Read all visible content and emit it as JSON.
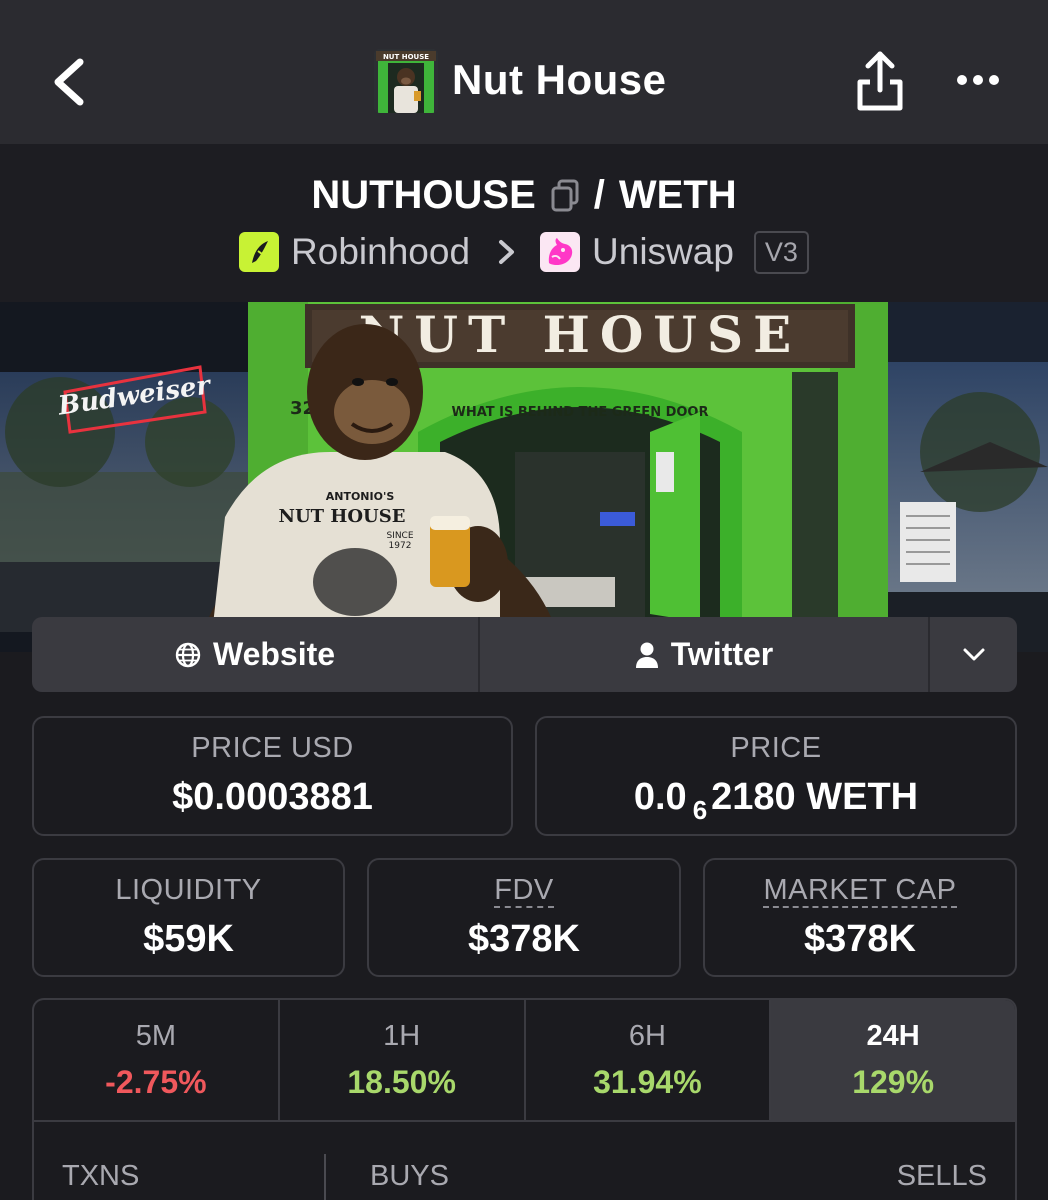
{
  "nav": {
    "title": "Nut House"
  },
  "pair": {
    "base_token": "NUTHOUSE",
    "separator": "/",
    "quote_token": "WETH",
    "chain": "Robinhood",
    "dex": "Uniswap",
    "version": "V3"
  },
  "banner": {
    "sign_text": "NUT HOUSE",
    "neon_text": "Budweiser",
    "door_text": "WHAT IS BEHIND THE GREEN DOOR",
    "shirt_top": "ANTONIO'S",
    "shirt_main": "NUT HOUSE",
    "shirt_since": "SINCE",
    "shirt_year": "1972",
    "street_number": "32"
  },
  "links": {
    "website_label": "Website",
    "twitter_label": "Twitter"
  },
  "stats": {
    "price_usd_label": "PRICE USD",
    "price_usd_value": "$0.0003881",
    "price_label": "PRICE",
    "price_prefix": "0.0",
    "price_zeros": "6",
    "price_digits": "2180 WETH",
    "liquidity_label": "LIQUIDITY",
    "liquidity_value": "$59K",
    "fdv_label": "FDV",
    "fdv_value": "$378K",
    "mcap_label": "MARKET CAP",
    "mcap_value": "$378K"
  },
  "changes": [
    {
      "label": "5M",
      "value": "-2.75%",
      "color": "#f0585c"
    },
    {
      "label": "1H",
      "value": "18.50%",
      "color": "#a8d86b"
    },
    {
      "label": "6H",
      "value": "31.94%",
      "color": "#a8d86b"
    },
    {
      "label": "24H",
      "value": "129%",
      "color": "#a8d86b"
    }
  ],
  "txns": {
    "txns_label": "TXNS",
    "buys_label": "BUYS",
    "sells_label": "SELLS"
  },
  "colors": {
    "positive": "#a8d86b",
    "negative": "#f0585c",
    "chain_accent": "#c8f234",
    "dex_accent": "#ff37c7",
    "door_green": "#5cc23a"
  }
}
